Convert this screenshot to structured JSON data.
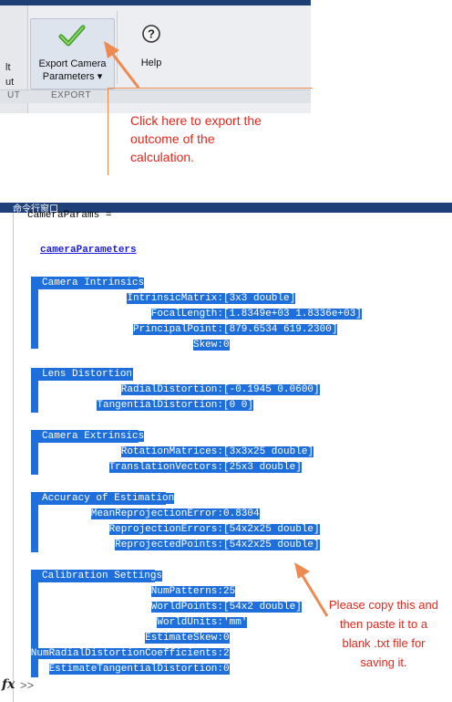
{
  "ribbon": {
    "left_partial_top": "lt",
    "left_partial_bottom": "ut",
    "left_group_partial": "UT",
    "export_button_line1": "Export Camera",
    "export_button_line2": "Parameters ▾",
    "help_button_label": "Help",
    "group_label": "EXPORT"
  },
  "annotation_top": {
    "line1": "Click here to export the",
    "line2": "outcome of the",
    "line3": "calculation."
  },
  "command_window": {
    "title": "命令行窗口",
    "var_assign": "cameraParams =",
    "class_link": "cameraParameters",
    "sections": [
      {
        "header": "Camera Intrinsics",
        "rows": [
          {
            "label": "IntrinsicMatrix:",
            "value": "[3x3 double]"
          },
          {
            "label": "FocalLength:",
            "value": "[1.8349e+03 1.8336e+03]"
          },
          {
            "label": "PrincipalPoint:",
            "value": "[879.6534 619.2300]"
          },
          {
            "label": "Skew:",
            "value": "0"
          }
        ]
      },
      {
        "header": "Lens Distortion",
        "rows": [
          {
            "label": "RadialDistortion:",
            "value": "[-0.1945 0.0600]"
          },
          {
            "label": "TangentialDistortion:",
            "value": "[0 0]"
          }
        ]
      },
      {
        "header": "Camera Extrinsics",
        "rows": [
          {
            "label": "RotationMatrices:",
            "value": "[3x3x25 double]"
          },
          {
            "label": "TranslationVectors:",
            "value": "[25x3 double]"
          }
        ]
      },
      {
        "header": "Accuracy of Estimation",
        "rows": [
          {
            "label": "MeanReprojectionError:",
            "value": "0.8304"
          },
          {
            "label": "ReprojectionErrors:",
            "value": "[54x2x25 double]"
          },
          {
            "label": "ReprojectedPoints:",
            "value": "[54x2x25 double]"
          }
        ]
      },
      {
        "header": "Calibration Settings",
        "rows": [
          {
            "label": "NumPatterns:",
            "value": "25"
          },
          {
            "label": "WorldPoints:",
            "value": "[54x2 double]"
          },
          {
            "label": "WorldUnits:",
            "value": "'mm'"
          },
          {
            "label": "EstimateSkew:",
            "value": "0"
          },
          {
            "label": "NumRadialDistortionCoefficients:",
            "value": "2"
          },
          {
            "label": "EstimateTangentialDistortion:",
            "value": "0"
          }
        ]
      }
    ],
    "fx_label": "fx",
    "prompt": ">>"
  },
  "annotation_bottom": {
    "line1": "Please copy this and",
    "line2": "then paste it to a",
    "line3": "blank .txt file for",
    "line4": "saving it."
  },
  "colors": {
    "selection": "#1e6fdc",
    "annotation_text": "#e3271b",
    "arrow": "#ee8a4f",
    "titlebar": "#1f3f78"
  }
}
